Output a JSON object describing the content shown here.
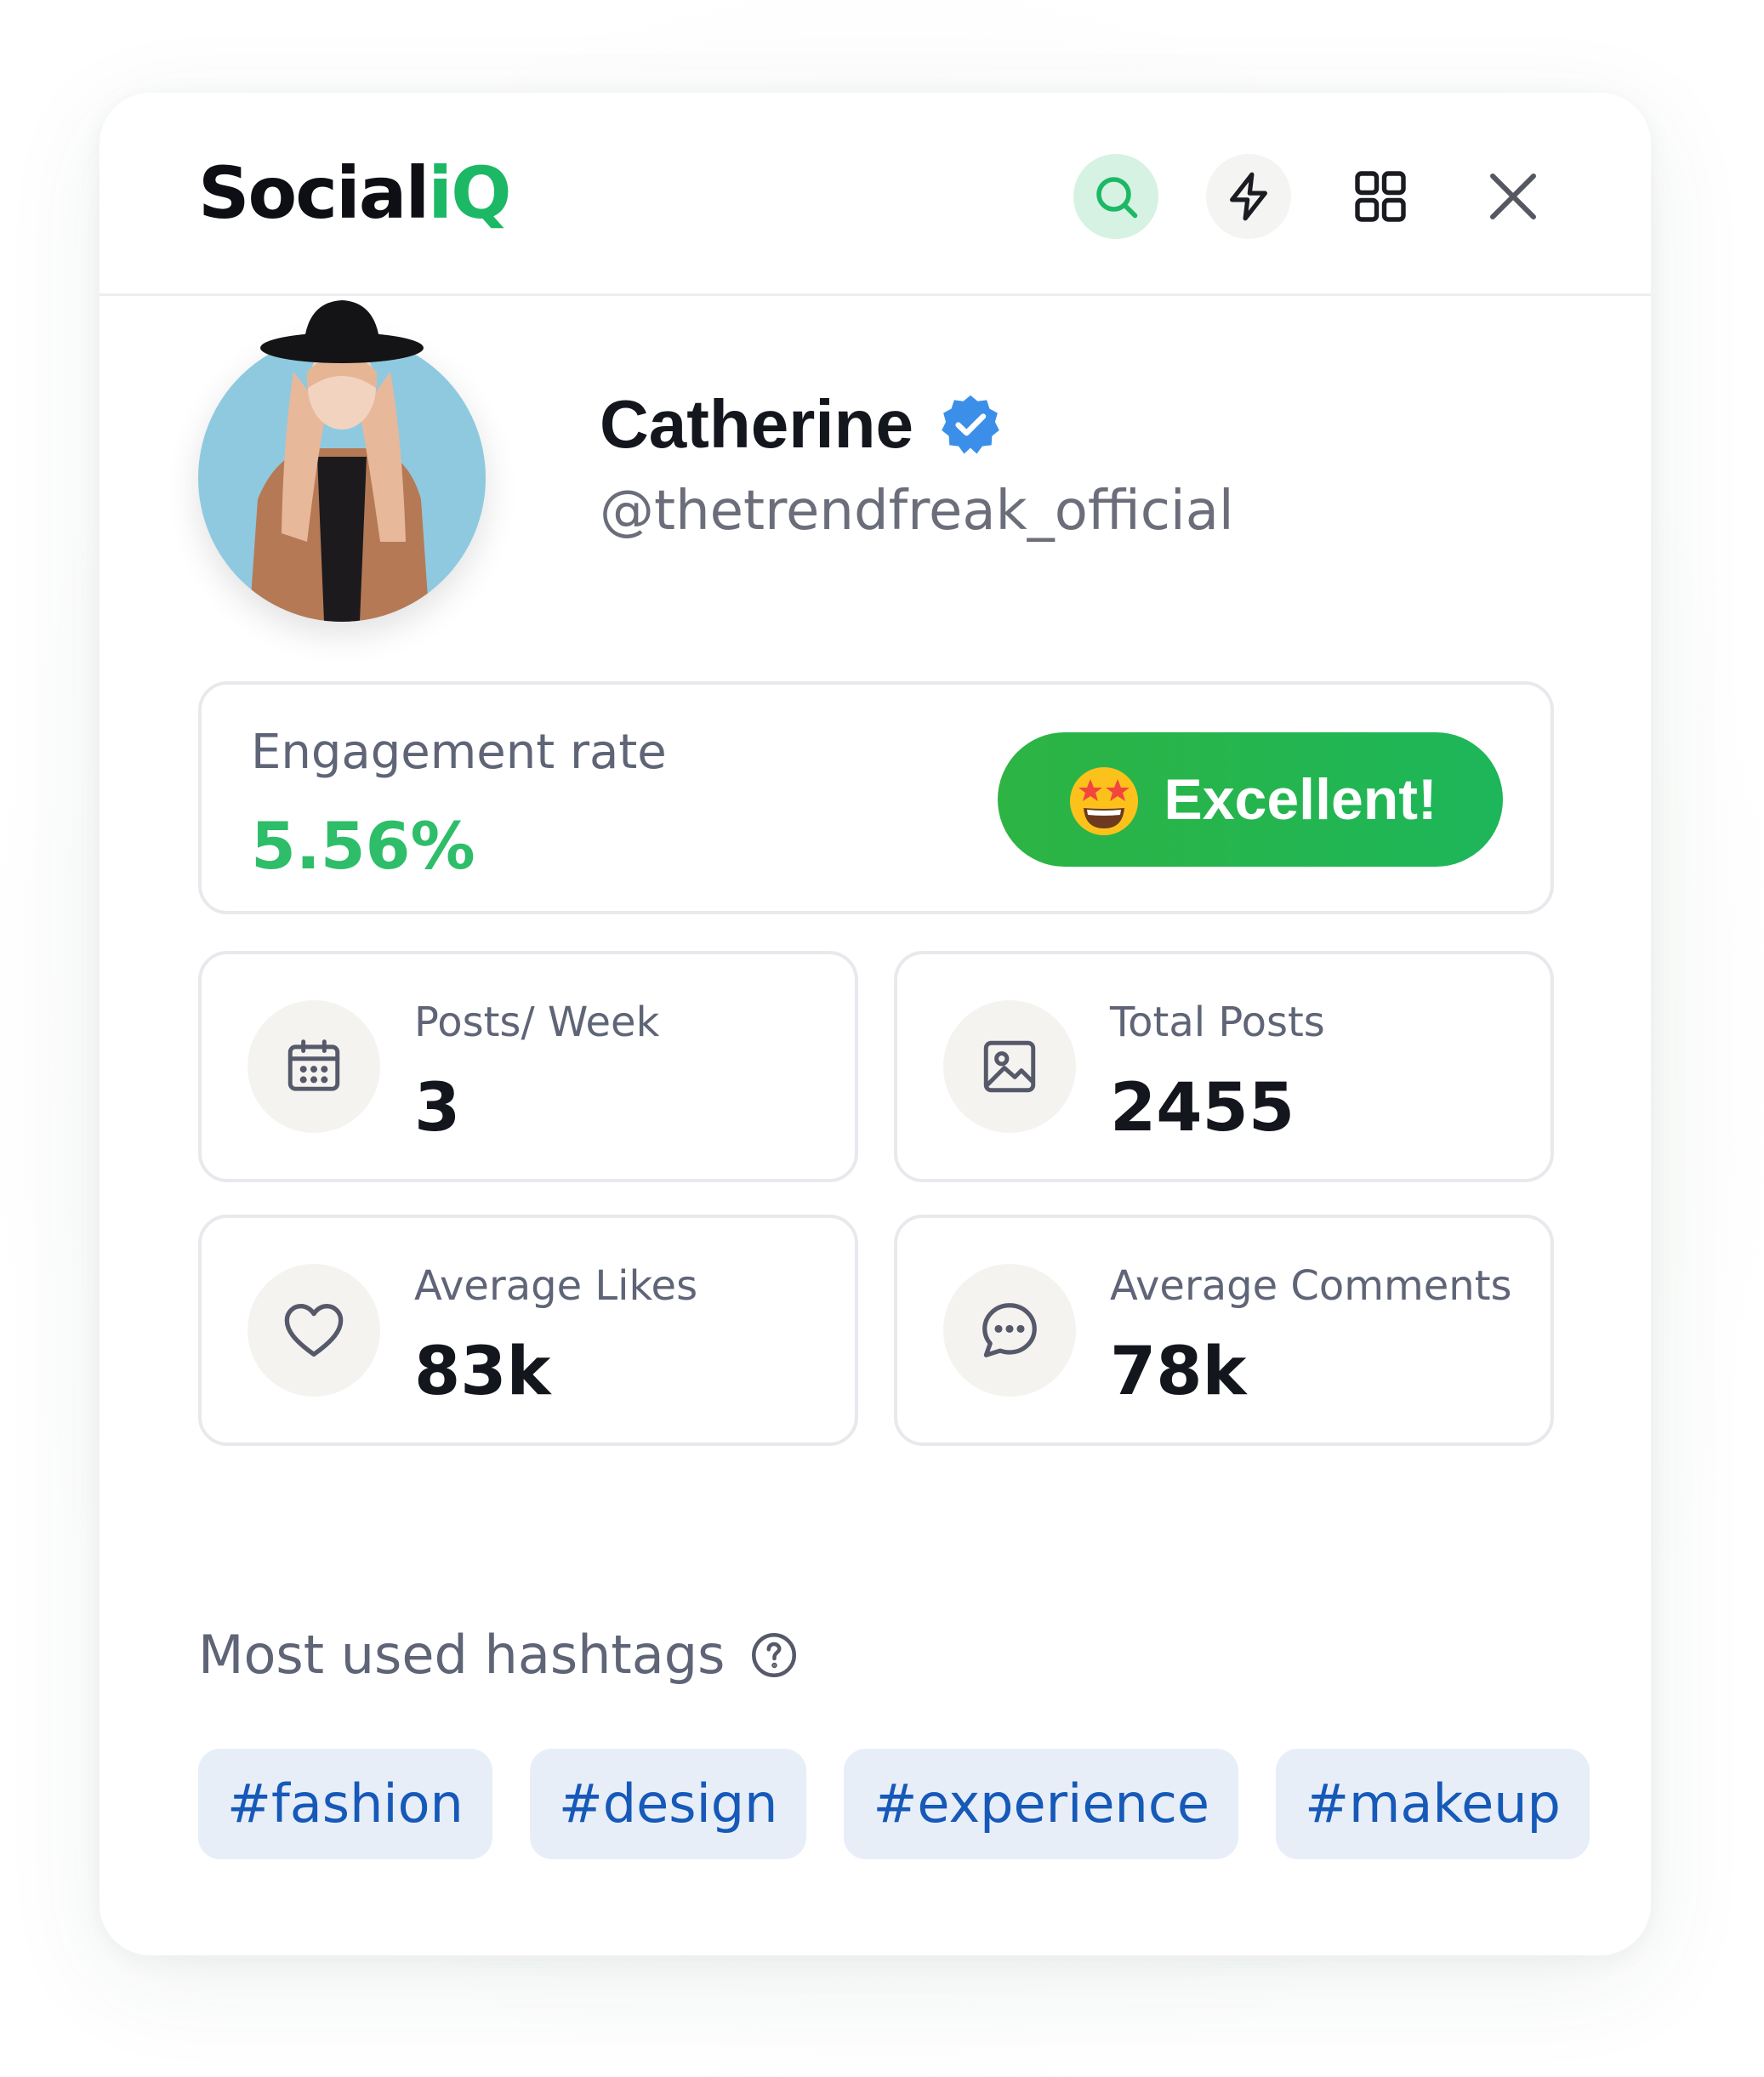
{
  "app": {
    "logo_main": "Social",
    "logo_accent": "iQ",
    "accent_color": "#1db865"
  },
  "header": {
    "buttons": [
      {
        "icon": "search-icon"
      },
      {
        "icon": "bolt-icon"
      },
      {
        "icon": "grid-icon"
      },
      {
        "icon": "close-icon"
      }
    ]
  },
  "profile": {
    "name": "Catherine",
    "verified": true,
    "handle": "@thetrendfreak_official"
  },
  "engagement": {
    "label": "Engagement rate",
    "value": "5.56%",
    "badge_label": "Excellent!",
    "badge_icon": "star-struck-emoji-icon",
    "value_color": "#2ebd69"
  },
  "stats": [
    {
      "icon": "calendar-icon",
      "label": "Posts/ Week",
      "value": "3"
    },
    {
      "icon": "image-icon",
      "label": "Total Posts",
      "value": "2455"
    },
    {
      "icon": "heart-icon",
      "label": "Average Likes",
      "value": "83k"
    },
    {
      "icon": "comment-icon",
      "label": "Average Comments",
      "value": "78k"
    }
  ],
  "hashtags": {
    "title": "Most used hashtags",
    "items": [
      "#fashion",
      "#design",
      "#experience",
      "#makeup"
    ]
  }
}
